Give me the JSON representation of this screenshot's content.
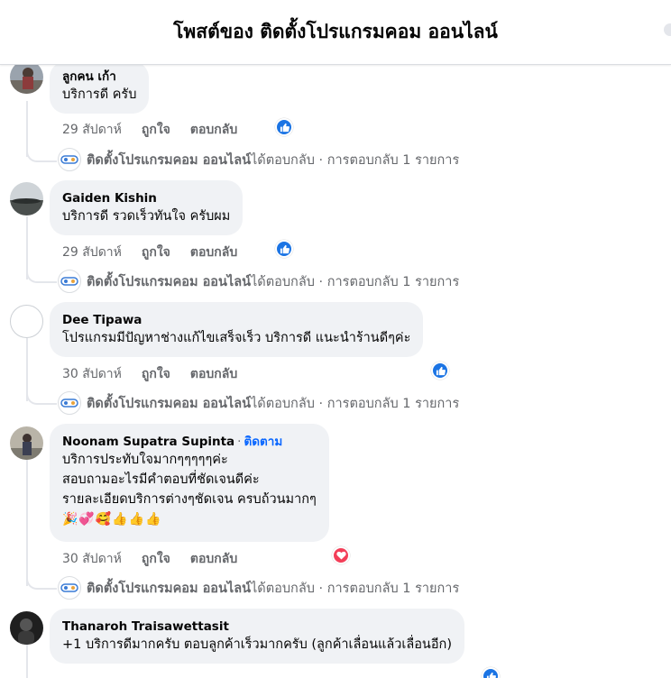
{
  "header": {
    "title": "โพสต์ของ ติดตั้งโปรแกรมคอม ออนไลน์"
  },
  "comments": [
    {
      "author": "ลูกคน เก้า",
      "lines": [
        "บริการดี ครับ"
      ],
      "time": "29 สัปดาห์",
      "like": "ถูกใจ",
      "reply": "ตอบกลับ",
      "reaction": "like",
      "page_reply": {
        "name": "ติดตั้งโปรแกรมคอม ออนไลน์",
        "text": " ได้ตอบกลับ · การตอบกลับ 1 รายการ"
      }
    },
    {
      "author": "Gaiden Kishin",
      "lines": [
        "บริการดี รวดเร็วทันใจ ครับผม"
      ],
      "time": "29 สัปดาห์",
      "like": "ถูกใจ",
      "reply": "ตอบกลับ",
      "reaction": "like",
      "page_reply": {
        "name": "ติดตั้งโปรแกรมคอม ออนไลน์",
        "text": " ได้ตอบกลับ · การตอบกลับ 1 รายการ"
      }
    },
    {
      "author": "Dee Tipawa",
      "lines": [
        "โปรแกรมมีปัญหาช่างแก้ไขเสร็จเร็ว บริการดี แนะนำร้านดีๆค่ะ"
      ],
      "time": "30 สัปดาห์",
      "like": "ถูกใจ",
      "reply": "ตอบกลับ",
      "reaction": "like",
      "page_reply": {
        "name": "ติดตั้งโปรแกรมคอม ออนไลน์",
        "text": " ได้ตอบกลับ · การตอบกลับ 1 รายการ"
      }
    },
    {
      "author": "Noonam Supatra Supinta",
      "follow": "ติดตาม",
      "lines": [
        "บริการประทับใจมากๆๆๆๆๆค่ะ",
        "สอบถามอะไรมีคำตอบที่ชัดเจนดีค่ะ",
        "รายละเอียดบริการต่างๆชัดเจน ครบถ้วนมากๆ"
      ],
      "emoji": "🎉💞🥰👍👍👍",
      "time": "30 สัปดาห์",
      "like": "ถูกใจ",
      "reply": "ตอบกลับ",
      "reaction": "love",
      "page_reply": {
        "name": "ติดตั้งโปรแกรมคอม ออนไลน์",
        "text": " ได้ตอบกลับ · การตอบกลับ 1 รายการ"
      }
    },
    {
      "author": "Thanaroh Traisawettasit",
      "lines": [
        "+1 บริการดีมากครับ ตอบลูกค้าเร็วมากครับ (ลูกค้าเลื่อนแล้วเลื่อนอีก)"
      ]
    }
  ],
  "colors": {
    "accent": "#0866ff",
    "like": "#1b74e4",
    "love": "#f33e58",
    "bubble": "#f0f2f5",
    "muted": "#65676b"
  }
}
